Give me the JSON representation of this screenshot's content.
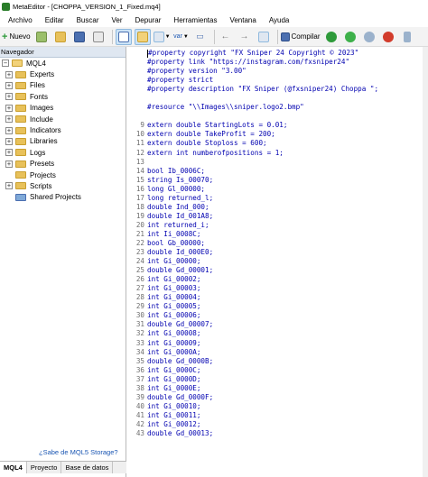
{
  "window": {
    "title": "MetaEditor - [CHOPPA_VERSION_1_Fixed.mq4]"
  },
  "menu": {
    "items": [
      "Archivo",
      "Editar",
      "Buscar",
      "Ver",
      "Depurar",
      "Herramientas",
      "Ventana",
      "Ayuda"
    ]
  },
  "toolbar": {
    "new_label": "Nuevo",
    "var_label": "var",
    "compile_label": "Compilar"
  },
  "navigator": {
    "title": "Navegador",
    "root": "MQL4",
    "items": [
      "Experts",
      "Files",
      "Fonts",
      "Images",
      "Include",
      "Indicators",
      "Libraries",
      "Logs",
      "Presets",
      "Projects",
      "Scripts",
      "Shared Projects"
    ],
    "storage_link": "¿Sabe de MQL5 Storage?",
    "tabs": [
      "MQL4",
      "Proyecto",
      "Base de datos"
    ]
  },
  "editor": {
    "lines": [
      {
        "n": "",
        "t": "#property copyright \"FX Sniper 24 Copyright © 2023\""
      },
      {
        "n": "",
        "t": "#property link \"https://instagram.com/fxsniper24\""
      },
      {
        "n": "",
        "t": "#property version \"3.00\""
      },
      {
        "n": "",
        "t": "#property strict"
      },
      {
        "n": "",
        "t": "#property description \"FX Sniper (@fxsniper24) Choppa \";"
      },
      {
        "n": "",
        "t": ""
      },
      {
        "n": "",
        "t": "#resource \"\\\\Images\\\\sniper.logo2.bmp\""
      },
      {
        "n": "",
        "t": ""
      },
      {
        "n": "9",
        "t": "extern double StartingLots = 0.01;"
      },
      {
        "n": "10",
        "t": "extern double TakeProfit = 200;"
      },
      {
        "n": "11",
        "t": "extern double Stoploss = 600;"
      },
      {
        "n": "12",
        "t": "extern int numberofpositions = 1;"
      },
      {
        "n": "13",
        "t": ""
      },
      {
        "n": "14",
        "t": "bool Ib_0006C;"
      },
      {
        "n": "15",
        "t": "string Is_00070;"
      },
      {
        "n": "16",
        "t": "long Gl_00000;"
      },
      {
        "n": "17",
        "t": "long returned_l;"
      },
      {
        "n": "18",
        "t": "double Ind_000;"
      },
      {
        "n": "19",
        "t": "double Id_001A8;"
      },
      {
        "n": "20",
        "t": "int returned_i;"
      },
      {
        "n": "21",
        "t": "int Ii_0008C;"
      },
      {
        "n": "22",
        "t": "bool Gb_00000;"
      },
      {
        "n": "23",
        "t": "double Id_000E0;"
      },
      {
        "n": "24",
        "t": "int Gi_00000;"
      },
      {
        "n": "25",
        "t": "double Gd_00001;"
      },
      {
        "n": "26",
        "t": "int Gi_00002;"
      },
      {
        "n": "27",
        "t": "int Gi_00003;"
      },
      {
        "n": "28",
        "t": "int Gi_00004;"
      },
      {
        "n": "29",
        "t": "int Gi_00005;"
      },
      {
        "n": "30",
        "t": "int Gi_00006;"
      },
      {
        "n": "31",
        "t": "double Gd_00007;"
      },
      {
        "n": "32",
        "t": "int Gi_00008;"
      },
      {
        "n": "33",
        "t": "int Gi_00009;"
      },
      {
        "n": "34",
        "t": "int Gi_0000A;"
      },
      {
        "n": "35",
        "t": "double Gd_0000B;"
      },
      {
        "n": "36",
        "t": "int Gi_0000C;"
      },
      {
        "n": "37",
        "t": "int Gi_0000D;"
      },
      {
        "n": "38",
        "t": "int Gi_0000E;"
      },
      {
        "n": "39",
        "t": "double Gd_0000F;"
      },
      {
        "n": "40",
        "t": "int Gi_00010;"
      },
      {
        "n": "41",
        "t": "int Gi_00011;"
      },
      {
        "n": "42",
        "t": "int Gi_00012;"
      },
      {
        "n": "43",
        "t": "double Gd_00013;"
      }
    ]
  },
  "colors": {
    "code_text": "#0000b0",
    "line_number": "#6d6d6d",
    "compile_green": "#2e9a3a",
    "stop_red": "#d23c2c"
  }
}
